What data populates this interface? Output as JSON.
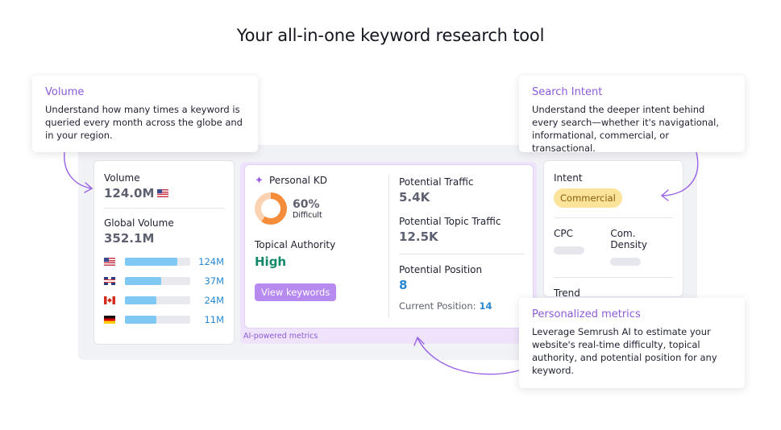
{
  "page": {
    "title": "Your all-in-one keyword research tool"
  },
  "volume_card": {
    "volume_label": "Volume",
    "volume_value": "124.0M",
    "global_label": "Global Volume",
    "global_value": "352.1M",
    "countries": [
      {
        "flag": "us-flag-icon",
        "value": "124M",
        "share": 0.8
      },
      {
        "flag": "uk-flag-icon",
        "value": "37M",
        "share": 0.56
      },
      {
        "flag": "canada-flag-icon",
        "value": "24M",
        "share": 0.48
      },
      {
        "flag": "germany-flag-icon",
        "value": "11M",
        "share": 0.48
      }
    ]
  },
  "ai_card": {
    "kd_label": "Personal KD",
    "kd_value": "60%",
    "kd_fraction": 0.6,
    "kd_level": "Difficult",
    "topical_label": "Topical Authority",
    "topical_value": "High",
    "view_button": "View keywords",
    "traffic_label": "Potential Traffic",
    "traffic_value": "5.4K",
    "topic_traffic_label": "Potential Topic Traffic",
    "topic_traffic_value": "12.5K",
    "position_label": "Potential Position",
    "position_value": "8",
    "current_label": "Current Position:",
    "current_value": "14",
    "caption": "AI-powered metrics"
  },
  "intent_card": {
    "intent_label": "Intent",
    "intent_value": "Commercial",
    "cpc_label": "CPC",
    "density_label": "Com. Density",
    "trend_label": "Trend"
  },
  "tooltips": {
    "volume": {
      "title": "Volume",
      "body": "Understand how many times a keyword is queried every month across the globe and in your region."
    },
    "intent": {
      "title": "Search Intent",
      "body": "Understand the deeper intent behind every search—whether it's navigational, informational, commercial, or transactional."
    },
    "personal": {
      "title": "Personalized metrics",
      "body": "Leverage Semrush AI to estimate your website's real-time difficulty, topical authority, and potential position for any keyword."
    }
  },
  "colors": {
    "accent_purple": "#8c5cd8",
    "link_blue": "#2a87cf",
    "high_green": "#12896a",
    "kd_orange": "#f48c3a",
    "intent_yellow": "#fbe39a"
  }
}
